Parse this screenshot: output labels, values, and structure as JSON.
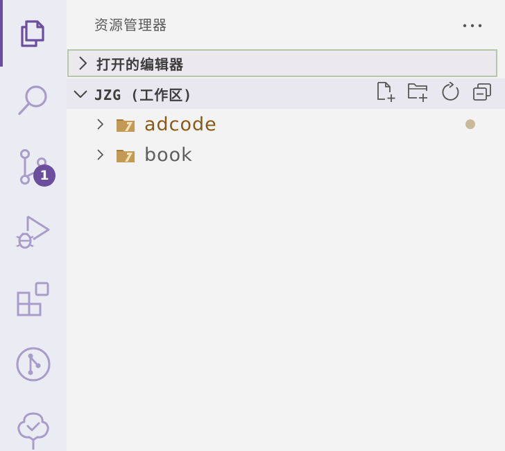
{
  "activity_bar": {
    "items": [
      {
        "name": "explorer",
        "icon": "files-icon",
        "active": true
      },
      {
        "name": "search",
        "icon": "search-icon"
      },
      {
        "name": "source-control",
        "icon": "source-control-icon",
        "badge": "1"
      },
      {
        "name": "run-debug",
        "icon": "run-debug-icon"
      },
      {
        "name": "extensions",
        "icon": "extensions-icon"
      },
      {
        "name": "git-graph",
        "icon": "git-graph-icon"
      },
      {
        "name": "testing",
        "icon": "testing-tree-icon"
      }
    ],
    "accent_color": "#6b4f9e",
    "icon_color": "#a89cc8"
  },
  "sidebar": {
    "title": "资源管理器",
    "more_icon": "ellipsis-icon",
    "sections": {
      "open_editors": {
        "label": "打开的编辑器",
        "collapsed": true
      },
      "workspace": {
        "label": "JZG (工作区)",
        "collapsed": false,
        "actions": [
          {
            "name": "new-file",
            "icon": "new-file-icon"
          },
          {
            "name": "new-folder",
            "icon": "new-folder-icon"
          },
          {
            "name": "refresh",
            "icon": "refresh-icon"
          },
          {
            "name": "collapse-all",
            "icon": "collapse-all-icon"
          }
        ]
      }
    },
    "tree": [
      {
        "label": "adcode",
        "type": "root-folder",
        "modified": true
      },
      {
        "label": "book",
        "type": "root-folder",
        "modified": false
      }
    ]
  }
}
